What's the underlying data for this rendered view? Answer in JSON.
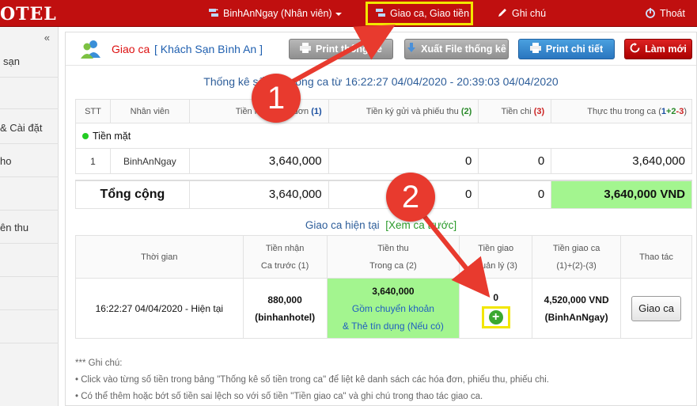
{
  "topbar": {
    "logo": "OTEL",
    "user_menu": "BinhAnNgay (Nhân viên)",
    "shift_menu": "Giao ca, Giao tiền",
    "notes_menu": "Ghi chú",
    "logout": "Thoát"
  },
  "sidebar": {
    "collapse": "«",
    "items": [
      "sạn",
      "& Cài đặt",
      "ho",
      "ên thu"
    ]
  },
  "header": {
    "title": "Giao ca",
    "subtitle": "[ Khách Sạn Bình An ]",
    "buttons": {
      "print_summary": "Print thống kê",
      "export_file": "Xuất File thống kê",
      "print_detail": "Print chi tiết",
      "refresh": "Làm mới"
    }
  },
  "stats": {
    "title": "Thống kê số tiền trong ca từ 16:22:27 04/04/2020 - 20:39:03 04/04/2020",
    "columns": {
      "stt": "STT",
      "staff": "Nhân viên",
      "invoice": "Tiền nhận hóa đơn",
      "invoice_ref": "(1)",
      "deposit": "Tiền ký gửi và phiếu thu",
      "deposit_ref": "(2)",
      "spend": "Tiền chi",
      "spend_ref": "(3)",
      "actual": "Thực thu trong ca",
      "actual_ref_open": "(",
      "actual_ref_1": "1",
      "actual_ref_2": "+2",
      "actual_ref_3": "-3",
      "actual_ref_close": ")"
    },
    "group_label": "Tiền mặt",
    "rows": [
      {
        "stt": "1",
        "staff": "BinhAnNgay",
        "invoice": "3,640,000",
        "deposit": "0",
        "spend": "0",
        "actual": "3,640,000"
      }
    ],
    "total": {
      "label": "Tổng cộng",
      "invoice": "3,640,000",
      "deposit": "0",
      "spend": "0",
      "actual": "3,640,000 VND"
    }
  },
  "current_shift": {
    "title": "Giao ca hiện tại",
    "prev_link": "[Xem ca trước]",
    "columns": {
      "time": "Thời gian",
      "prev_l1": "Tiền nhận",
      "prev_l2": "Ca trước (1)",
      "in_l1": "Tiền thu",
      "in_l2": "Trong ca (2)",
      "mgr_l1": "Tiền giao",
      "mgr_l2": "Quản lý (3)",
      "handover_l1": "Tiền giao ca",
      "handover_l2": "(1)+(2)-(3)",
      "action": "Thao tác"
    },
    "row": {
      "time": "16:22:27 04/04/2020 - Hiện tại",
      "prev_amount": "880,000",
      "prev_user": "(binhanhotel)",
      "in_amount": "3,640,000",
      "in_note1": "Gồm chuyển khoản",
      "in_note2": "& Thẻ tín dụng (Nếu có)",
      "mgr_amount": "0",
      "handover_amount": "4,520,000 VND",
      "handover_user": "(BinhAnNgay)",
      "action_button": "Giao ca"
    }
  },
  "notes": {
    "heading": "*** Ghi chú:",
    "lines": [
      "• Click vào từng số tiền trong bảng \"Thống kê số tiền trong ca\" để liệt kê danh sách các hóa đơn, phiếu thu, phiếu chi.",
      "• Có thể thêm hoặc bớt số tiền sai lệch so với số tiền \"Tiền giao ca\" và ghi chú trong thao tác giao ca."
    ]
  },
  "annotations": {
    "badge1": "1",
    "badge2": "2"
  },
  "colors": {
    "topbar": "#c00f0f",
    "highlight": "#f2e600",
    "badge": "#e83a2e",
    "green_cell": "#a3f58f"
  }
}
